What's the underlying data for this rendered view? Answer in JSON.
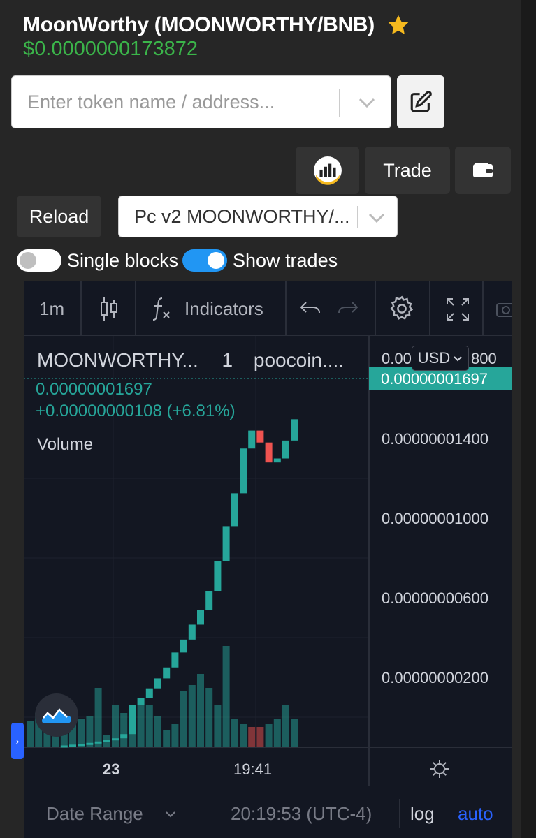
{
  "header": {
    "title": "MoonWorthy (MOONWORTHY/BNB)",
    "price": "$0.0000000173872"
  },
  "search": {
    "placeholder": "Enter token name / address..."
  },
  "toolbar": {
    "trade_label": "Trade",
    "reload_label": "Reload"
  },
  "pair_select": {
    "value": "Pc v2 MOONWORTHY/..."
  },
  "toggles": {
    "single_blocks": {
      "label": "Single blocks",
      "on": false
    },
    "show_trades": {
      "label": "Show trades",
      "on": true
    }
  },
  "chart_toolbar": {
    "interval": "1m",
    "indicators_label": "Indicators"
  },
  "chart_legend": {
    "symbol": "MOONWORTHY...",
    "interval": "1",
    "source": "poocoin....",
    "last_price": "0.00000001697",
    "change": "+0.00000000108 (+6.81%)",
    "volume_label": "Volume"
  },
  "price_axis": {
    "currency": "USD",
    "top_partial_left": "0.00",
    "top_partial_right": "800",
    "current_price_tag": "0.00000001697",
    "ticks": [
      "0.00000001400",
      "0.00000001000",
      "0.00000000600",
      "0.00000000200"
    ]
  },
  "time_axis": {
    "labels": [
      "23",
      "19:41"
    ]
  },
  "bottom_bar": {
    "date_range": "Date Range",
    "time": "20:19:53 (UTC-4)",
    "log": "log",
    "auto": "auto"
  },
  "colors": {
    "up": "#26a69a",
    "down": "#ef5350",
    "price_green": "#3bb54a",
    "accent_blue": "#2196f3",
    "auto_blue": "#2962ff",
    "star": "#f5b91e"
  },
  "chart_data": {
    "type": "candlestick",
    "x_labels": [
      "23",
      "19:41"
    ],
    "y_ticks": [
      2e-09,
      6e-09,
      1e-08,
      1.4e-08
    ],
    "last_price": 1.697e-08,
    "candles": [
      {
        "o": 5e-10,
        "c": 5.8e-10,
        "dir": "up"
      },
      {
        "o": 5.8e-10,
        "c": 6.2e-10,
        "dir": "up"
      },
      {
        "o": 6.2e-10,
        "c": 6.6e-10,
        "dir": "up"
      },
      {
        "o": 6.6e-10,
        "c": 7.1e-10,
        "dir": "up"
      },
      {
        "o": 7.1e-10,
        "c": 7.8e-10,
        "dir": "up"
      },
      {
        "o": 7.8e-10,
        "c": 8.5e-10,
        "dir": "up"
      },
      {
        "o": 8.5e-10,
        "c": 9.4e-10,
        "dir": "up"
      },
      {
        "o": 9.4e-10,
        "c": 1.15e-09,
        "dir": "up"
      },
      {
        "o": 1.15e-09,
        "c": 2.6e-09,
        "dir": "up"
      },
      {
        "o": 2.6e-09,
        "c": 2.95e-09,
        "dir": "up"
      },
      {
        "o": 2.95e-09,
        "c": 3.45e-09,
        "dir": "up"
      },
      {
        "o": 3.45e-09,
        "c": 3.95e-09,
        "dir": "up"
      },
      {
        "o": 3.95e-09,
        "c": 4.5e-09,
        "dir": "up"
      },
      {
        "o": 4.5e-09,
        "c": 5.25e-09,
        "dir": "up"
      },
      {
        "o": 5.25e-09,
        "c": 5.9e-09,
        "dir": "up"
      },
      {
        "o": 5.9e-09,
        "c": 6.65e-09,
        "dir": "up"
      },
      {
        "o": 6.65e-09,
        "c": 7.4e-09,
        "dir": "up"
      },
      {
        "o": 7.4e-09,
        "c": 8.35e-09,
        "dir": "up"
      },
      {
        "o": 8.35e-09,
        "c": 9.85e-09,
        "dir": "up"
      },
      {
        "o": 9.85e-09,
        "c": 1.16e-08,
        "dir": "up"
      },
      {
        "o": 1.16e-08,
        "c": 1.325e-08,
        "dir": "up"
      },
      {
        "o": 1.325e-08,
        "c": 1.55e-08,
        "dir": "up"
      },
      {
        "o": 1.55e-08,
        "c": 1.64e-08,
        "dir": "up"
      },
      {
        "o": 1.64e-08,
        "c": 1.58e-08,
        "dir": "down"
      },
      {
        "o": 1.58e-08,
        "c": 1.48e-08,
        "dir": "down"
      },
      {
        "o": 1.48e-08,
        "c": 1.5e-08,
        "dir": "up"
      },
      {
        "o": 1.5e-08,
        "c": 1.59e-08,
        "dir": "up"
      },
      {
        "o": 1.59e-08,
        "c": 1.697e-08,
        "dir": "up"
      }
    ],
    "volumes": [
      {
        "v": 0.45,
        "dir": "up"
      },
      {
        "v": 0.6,
        "dir": "up"
      },
      {
        "v": 0.55,
        "dir": "up"
      },
      {
        "v": 0.4,
        "dir": "up"
      },
      {
        "v": 0.4,
        "dir": "up"
      },
      {
        "v": 0.45,
        "dir": "up"
      },
      {
        "v": 0.5,
        "dir": "up"
      },
      {
        "v": 0.55,
        "dir": "up"
      },
      {
        "v": 1.05,
        "dir": "up"
      },
      {
        "v": 0.2,
        "dir": "up"
      },
      {
        "v": 0.75,
        "dir": "up"
      },
      {
        "v": 0.6,
        "dir": "up"
      },
      {
        "v": 0.55,
        "dir": "up"
      },
      {
        "v": 0.75,
        "dir": "up"
      },
      {
        "v": 0.75,
        "dir": "up"
      },
      {
        "v": 0.55,
        "dir": "up"
      },
      {
        "v": 0.3,
        "dir": "up"
      },
      {
        "v": 0.4,
        "dir": "up"
      },
      {
        "v": 1.0,
        "dir": "up"
      },
      {
        "v": 1.1,
        "dir": "up"
      },
      {
        "v": 1.3,
        "dir": "up"
      },
      {
        "v": 1.05,
        "dir": "up"
      },
      {
        "v": 0.75,
        "dir": "up"
      },
      {
        "v": 1.8,
        "dir": "up"
      },
      {
        "v": 0.5,
        "dir": "up"
      },
      {
        "v": 0.4,
        "dir": "up"
      },
      {
        "v": 0.35,
        "dir": "down"
      },
      {
        "v": 0.35,
        "dir": "down"
      },
      {
        "v": 0.4,
        "dir": "up"
      },
      {
        "v": 0.5,
        "dir": "up"
      },
      {
        "v": 0.75,
        "dir": "up"
      },
      {
        "v": 0.5,
        "dir": "up"
      }
    ]
  }
}
